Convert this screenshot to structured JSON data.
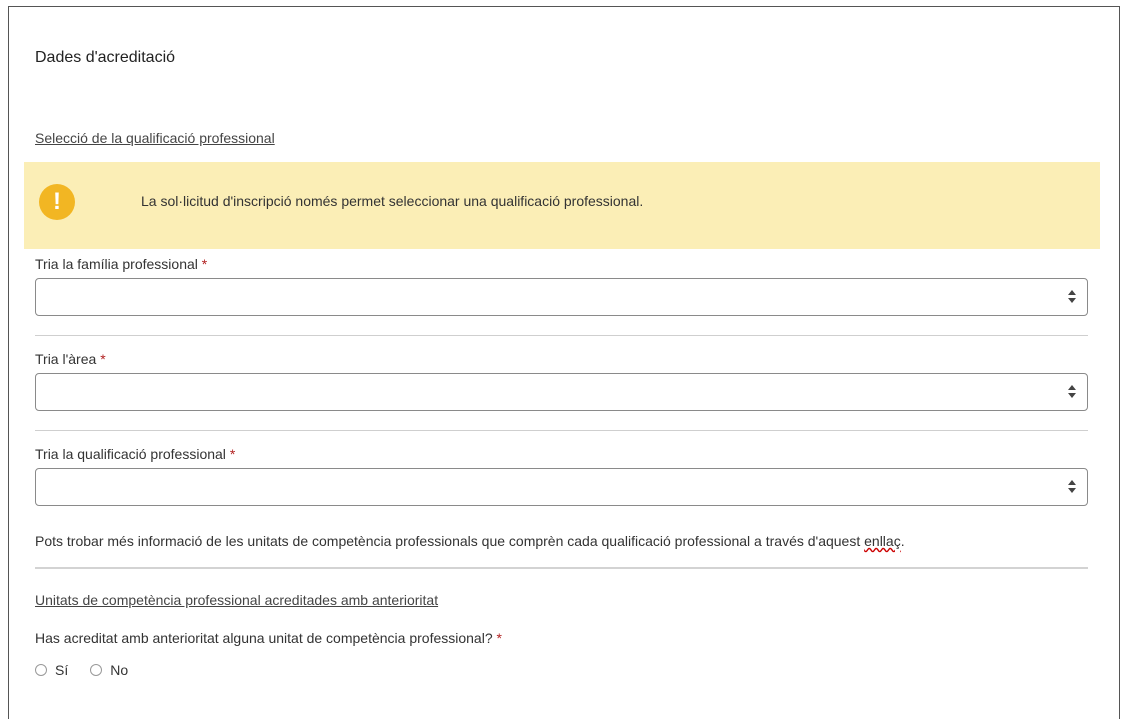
{
  "title": "Dades d'acreditació",
  "section1": "Selecció de la qualificació professional",
  "alert": {
    "icon": "exclamation-icon",
    "text": "La sol·licitud d'inscripció només permet seleccionar una qualificació professional."
  },
  "fields": {
    "familia": "Tria la família professional",
    "area": "Tria l'àrea",
    "qualificacio": "Tria la qualificació professional",
    "required_mark": "*"
  },
  "info": {
    "text": "Pots trobar més informació de les unitats de competència professionals que comprèn cada qualificació professional a través d'aquest ",
    "link": "enllaç",
    "suffix": "."
  },
  "section2": "Unitats de competència professional acreditades amb anterioritat",
  "question": "Has acreditat amb anterioritat alguna unitat de competència professional?",
  "options": {
    "yes": "Sí",
    "no": "No"
  }
}
